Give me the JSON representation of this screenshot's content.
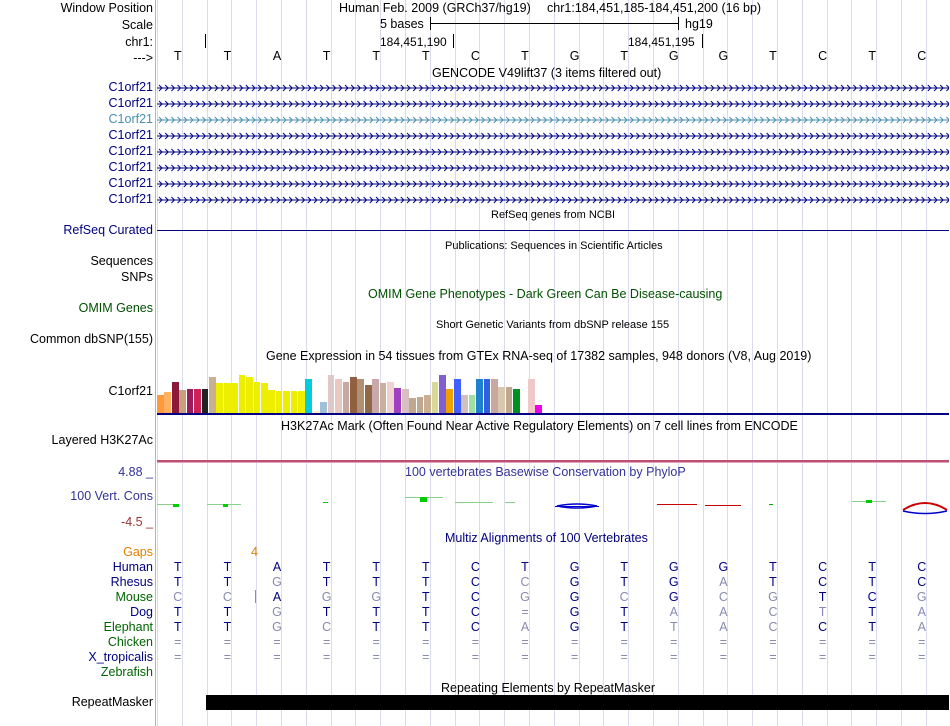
{
  "header": {
    "window_position_label": "Window Position",
    "scale_label": "Scale",
    "chr_label": "chr1:",
    "strand_label": "--->",
    "assembly": "Human Feb. 2009 (GRCh37/hg19)",
    "position": "chr1:184,451,185-184,451,200 (16 bp)",
    "scale_text": "5 bases",
    "scale_db": "hg19",
    "coord_left": "184,451,190",
    "coord_right": "184,451,195"
  },
  "bases": [
    "T",
    "T",
    "A",
    "T",
    "T",
    "T",
    "C",
    "T",
    "G",
    "T",
    "G",
    "G",
    "T",
    "C",
    "T",
    "C"
  ],
  "gencode": {
    "title": "GENCODE V49lift37 (3 items filtered out)",
    "genes": [
      "C1orf21",
      "C1orf21",
      "C1orf21",
      "C1orf21",
      "C1orf21",
      "C1orf21",
      "C1orf21",
      "C1orf21"
    ],
    "highlight_index": 2
  },
  "refseq": {
    "title": "RefSeq genes from NCBI",
    "label": "RefSeq Curated"
  },
  "publications": {
    "title": "Publications: Sequences in Scientific Articles",
    "label1": "Sequences",
    "label2": "SNPs"
  },
  "omim": {
    "label": "OMIM Genes",
    "title": "OMIM Gene Phenotypes - Dark Green Can Be Disease-causing"
  },
  "dbsnp": {
    "title": "Short Genetic Variants from dbSNP release 155",
    "label": "Common dbSNP(155)"
  },
  "gtex": {
    "title": "Gene Expression in 54 tissues from GTEx RNA-seq of 17382 samples, 948 donors (V8, Aug 2019)",
    "label": "C1orf21",
    "bars": [
      {
        "v": 0.55,
        "c": "#ff9a3c"
      },
      {
        "v": 0.65,
        "c": "#ffb060"
      },
      {
        "v": 0.95,
        "c": "#8b1a3a"
      },
      {
        "v": 0.7,
        "c": "#c8a080"
      },
      {
        "v": 0.72,
        "c": "#9b1c5c"
      },
      {
        "v": 0.72,
        "c": "#cc2255"
      },
      {
        "v": 0.72,
        "c": "#222222"
      },
      {
        "v": 1.1,
        "c": "#c8b090"
      },
      {
        "v": 0.9,
        "c": "#eeee00"
      },
      {
        "v": 0.9,
        "c": "#eeee00"
      },
      {
        "v": 0.9,
        "c": "#eeee00"
      },
      {
        "v": 1.15,
        "c": "#eeee00"
      },
      {
        "v": 1.1,
        "c": "#eeee00"
      },
      {
        "v": 0.95,
        "c": "#eeee00"
      },
      {
        "v": 0.9,
        "c": "#eeee00"
      },
      {
        "v": 0.7,
        "c": "#eeee00"
      },
      {
        "v": 0.68,
        "c": "#eeee00"
      },
      {
        "v": 0.68,
        "c": "#eeee00"
      },
      {
        "v": 0.68,
        "c": "#eeee00"
      },
      {
        "v": 0.68,
        "c": "#eeee00"
      },
      {
        "v": 1.05,
        "c": "#00ccdd"
      },
      {
        "v": 0.05,
        "c": "#ffeecc"
      },
      {
        "v": 0.35,
        "c": "#a0c0d8"
      },
      {
        "v": 1.15,
        "c": "#e0c8c8"
      },
      {
        "v": 1.05,
        "c": "#e8c8c0"
      },
      {
        "v": 0.95,
        "c": "#c8a8a0"
      },
      {
        "v": 1.1,
        "c": "#906040"
      },
      {
        "v": 1.05,
        "c": "#b09070"
      },
      {
        "v": 0.85,
        "c": "#906848"
      },
      {
        "v": 1.05,
        "c": "#c8a8a8"
      },
      {
        "v": 0.9,
        "c": "#c8b0a0"
      },
      {
        "v": 0.95,
        "c": "#f0d0d0"
      },
      {
        "v": 0.75,
        "c": "#a040c0"
      },
      {
        "v": 0.72,
        "c": "#d8c0c0"
      },
      {
        "v": 0.45,
        "c": "#c0a890"
      },
      {
        "v": 0.5,
        "c": "#c0a890"
      },
      {
        "v": 0.55,
        "c": "#c8b090"
      },
      {
        "v": 0.95,
        "c": "#d8d898"
      },
      {
        "v": 1.15,
        "c": "#8060d0"
      },
      {
        "v": 0.72,
        "c": "#f0a000"
      },
      {
        "v": 1.05,
        "c": "#4060ff"
      },
      {
        "v": 0.55,
        "c": "#d0c0c0"
      },
      {
        "v": 0.55,
        "c": "#a0e0a0"
      },
      {
        "v": 1.05,
        "c": "#2080d0"
      },
      {
        "v": 1.05,
        "c": "#3060e0"
      },
      {
        "v": 1.05,
        "c": "#c8a8a0"
      },
      {
        "v": 0.8,
        "c": "#d8c8b0"
      },
      {
        "v": 0.8,
        "c": "#c0a890"
      },
      {
        "v": 0.72,
        "c": "#009020"
      },
      {
        "v": 0.15,
        "c": "#ffffff"
      },
      {
        "v": 1.05,
        "c": "#f0c8c8"
      },
      {
        "v": 0.25,
        "c": "#ee00ee"
      }
    ]
  },
  "h3k27ac": {
    "label": "Layered H3K27Ac",
    "title": "H3K27Ac Mark (Often Found Near Active Regulatory Elements) on 7 cell lines from ENCODE"
  },
  "phylop": {
    "title": "100 vertebrates Basewise Conservation by PhyloP",
    "label": "100 Vert. Cons",
    "ymax": "4.88 _",
    "ymin": "-4.5 _"
  },
  "multiz": {
    "title": "Multiz Alignments of 100 Vertebrates",
    "gaps_label": "Gaps",
    "gaps_value": "4",
    "species": [
      {
        "name": "Human",
        "bases": [
          "T",
          "T",
          "A",
          "T",
          "T",
          "T",
          "C",
          "T",
          "G",
          "T",
          "G",
          "G",
          "T",
          "C",
          "T",
          "C"
        ],
        "dim": []
      },
      {
        "name": "Rhesus",
        "bases": [
          "T",
          "T",
          "G",
          "T",
          "T",
          "T",
          "C",
          "C",
          "G",
          "T",
          "G",
          "A",
          "T",
          "C",
          "T",
          "C"
        ],
        "dim": [
          2,
          7,
          11
        ]
      },
      {
        "name": "Mouse",
        "bases": [
          "C",
          "C",
          "A",
          "G",
          "G",
          "T",
          "C",
          "G",
          "G",
          "C",
          "G",
          "C",
          "G",
          "T",
          "C",
          "G"
        ],
        "dim": [
          0,
          1,
          3,
          4,
          7,
          9,
          11,
          12,
          15
        ]
      },
      {
        "name": "Dog",
        "bases": [
          "T",
          "T",
          "G",
          "T",
          "T",
          "T",
          "C",
          "=",
          "G",
          "T",
          "A",
          "A",
          "C",
          "T",
          "T",
          "A"
        ],
        "dim": [
          2,
          7,
          10,
          11,
          12,
          13,
          15
        ]
      },
      {
        "name": "Elephant",
        "bases": [
          "T",
          "T",
          "G",
          "C",
          "T",
          "T",
          "C",
          "A",
          "G",
          "T",
          "T",
          "A",
          "C",
          "C",
          "T",
          "A"
        ],
        "dim": [
          2,
          3,
          7,
          10,
          11,
          12,
          15
        ]
      },
      {
        "name": "Chicken",
        "bases": [
          "=",
          "=",
          "=",
          "=",
          "=",
          "=",
          "=",
          "=",
          "=",
          "=",
          "=",
          "=",
          "=",
          "=",
          "=",
          "="
        ],
        "dim": []
      },
      {
        "name": "X_tropicalis",
        "bases": [
          "=",
          "=",
          "=",
          "=",
          "=",
          "=",
          "=",
          "=",
          "=",
          "=",
          "=",
          "=",
          "=",
          "=",
          "=",
          "="
        ],
        "dim": []
      },
      {
        "name": "Zebrafish",
        "bases": [
          "",
          "",
          "",
          "",
          "",
          "",
          "",
          "",
          "",
          "",
          "",
          "",
          "",
          "",
          "",
          ""
        ],
        "dim": []
      }
    ]
  },
  "repeatmasker": {
    "title": "Repeating Elements by RepeatMasker",
    "label": "RepeatMasker"
  },
  "colors": {
    "track_label": "#000080",
    "omim_green": "#005000",
    "multiz_green": "#006400",
    "gaps_orange": "#e08000",
    "phylop_title": "#333399",
    "phylop_max": "#333399",
    "phylop_min": "#993333",
    "highlight_gene": "#4a8fb0"
  }
}
